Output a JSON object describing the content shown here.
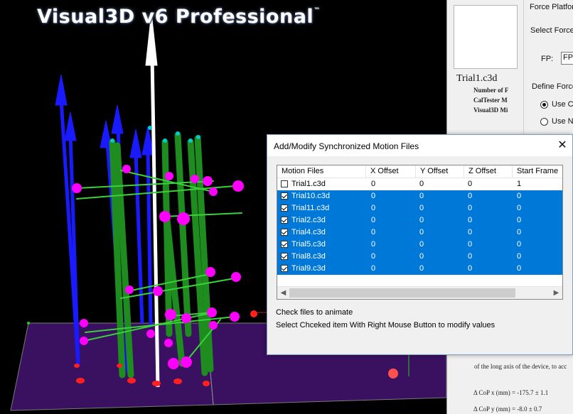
{
  "app": {
    "title": "Visual3D v6 Professional",
    "trademark": "™"
  },
  "right_panel": {
    "trial_name": "Trial1.c3d",
    "info_lines": [
      "Number of F",
      "CalTester M",
      "Visual3D Mi"
    ],
    "group_title": "Force Platfor",
    "select_label": "Select Force",
    "fp_label": "FP:",
    "fp_value": "FP",
    "define_label": "Define Force",
    "radio_1": "Use Cu",
    "radio_2": "Use No",
    "doc_line_1": "of the long axis of the device, to acc",
    "cop_x": "Δ CoP x (mm) = -175.7  ±  1.1",
    "cop_y": "Δ CoP y (mm) = -8.0  ±  0.7"
  },
  "dialog": {
    "title": "Add/Modify Synchronized Motion Files",
    "close_glyph": "✕",
    "columns": [
      "Motion Files",
      "X Offset",
      "Y Offset",
      "Z Offset",
      "Start Frame"
    ],
    "rows": [
      {
        "file": "Trial1.c3d",
        "x": "0",
        "y": "0",
        "z": "0",
        "start": "1",
        "checked": false,
        "selected": false
      },
      {
        "file": "Trial10.c3d",
        "x": "0",
        "y": "0",
        "z": "0",
        "start": "0",
        "checked": true,
        "selected": true
      },
      {
        "file": "Trial11.c3d",
        "x": "0",
        "y": "0",
        "z": "0",
        "start": "0",
        "checked": true,
        "selected": true
      },
      {
        "file": "Trial2.c3d",
        "x": "0",
        "y": "0",
        "z": "0",
        "start": "0",
        "checked": true,
        "selected": true
      },
      {
        "file": "Trial4.c3d",
        "x": "0",
        "y": "0",
        "z": "0",
        "start": "0",
        "checked": true,
        "selected": true
      },
      {
        "file": "Trial5.c3d",
        "x": "0",
        "y": "0",
        "z": "0",
        "start": "0",
        "checked": true,
        "selected": true
      },
      {
        "file": "Trial8.c3d",
        "x": "0",
        "y": "0",
        "z": "0",
        "start": "0",
        "checked": true,
        "selected": true
      },
      {
        "file": "Trial9.c3d",
        "x": "0",
        "y": "0",
        "z": "0",
        "start": "0",
        "checked": true,
        "selected": true
      }
    ],
    "scroll_left": "◀",
    "scroll_right": "▶",
    "hint_1": "Check files to animate",
    "hint_2": "Select Chceked item With Right Mouse Button to modify values"
  },
  "colors": {
    "selection": "#0078d7",
    "vector_blue": "#1a1aff",
    "segment_green": "#1e8c1e",
    "marker_magenta": "#ff00ff",
    "plate": "#3a1060"
  }
}
